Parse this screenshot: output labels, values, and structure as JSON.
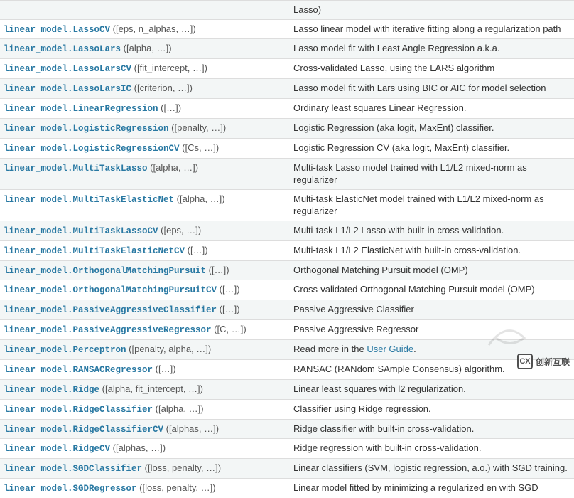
{
  "top_fragment": "Lasso)",
  "rows": [
    {
      "name": "linear_model.LassoCV",
      "params": " ([eps, n_alphas, …])",
      "desc": "Lasso linear model with iterative fitting along a regularization path"
    },
    {
      "name": "linear_model.LassoLars",
      "params": " ([alpha, …])",
      "desc": "Lasso model fit with Least Angle Regression a.k.a."
    },
    {
      "name": "linear_model.LassoLarsCV",
      "params": " ([fit_intercept, …])",
      "desc": "Cross-validated Lasso, using the LARS algorithm"
    },
    {
      "name": "linear_model.LassoLarsIC",
      "params": " ([criterion, …])",
      "desc": "Lasso model fit with Lars using BIC or AIC for model selection"
    },
    {
      "name": "linear_model.LinearRegression",
      "params": " ([…])",
      "desc": "Ordinary least squares Linear Regression."
    },
    {
      "name": "linear_model.LogisticRegression",
      "params": " ([penalty, …])",
      "desc": "Logistic Regression (aka logit, MaxEnt) classifier."
    },
    {
      "name": "linear_model.LogisticRegressionCV",
      "params": " ([Cs, …])",
      "desc": "Logistic Regression CV (aka logit, MaxEnt) classifier."
    },
    {
      "name": "linear_model.MultiTaskLasso",
      "params": " ([alpha, …])",
      "desc": "Multi-task Lasso model trained with L1/L2 mixed-norm as regularizer"
    },
    {
      "name": "linear_model.MultiTaskElasticNet",
      "params": " ([alpha, …])",
      "desc": "Multi-task ElasticNet model trained with L1/L2 mixed-norm as regularizer"
    },
    {
      "name": "linear_model.MultiTaskLassoCV",
      "params": " ([eps, …])",
      "desc": "Multi-task L1/L2 Lasso with built-in cross-validation."
    },
    {
      "name": "linear_model.MultiTaskElasticNetCV",
      "params": " ([…])",
      "desc": "Multi-task L1/L2 ElasticNet with built-in cross-validation."
    },
    {
      "name": "linear_model.OrthogonalMatchingPursuit",
      "params": " ([…])",
      "desc": "Orthogonal Matching Pursuit model (OMP)"
    },
    {
      "name": "linear_model.OrthogonalMatchingPursuitCV",
      "params": " ([…])",
      "desc": "Cross-validated Orthogonal Matching Pursuit model (OMP)"
    },
    {
      "name": "linear_model.PassiveAggressiveClassifier",
      "params": " ([…])",
      "desc": "Passive Aggressive Classifier"
    },
    {
      "name": "linear_model.PassiveAggressiveRegressor",
      "params": " ([C, …])",
      "desc": "Passive Aggressive Regressor"
    },
    {
      "name": "linear_model.Perceptron",
      "params": " ([penalty, alpha, …])",
      "desc_prefix": "Read more in the ",
      "link_text": "User Guide",
      "desc_suffix": "."
    },
    {
      "name": "linear_model.RANSACRegressor",
      "params": " ([…])",
      "desc": "RANSAC (RANdom SAmple Consensus) algorithm."
    },
    {
      "name": "linear_model.Ridge",
      "params": " ([alpha, fit_intercept, …])",
      "desc": "Linear least squares with l2 regularization."
    },
    {
      "name": "linear_model.RidgeClassifier",
      "params": " ([alpha, …])",
      "desc": "Classifier using Ridge regression."
    },
    {
      "name": "linear_model.RidgeClassifierCV",
      "params": " ([alphas, …])",
      "desc": "Ridge classifier with built-in cross-validation."
    },
    {
      "name": "linear_model.RidgeCV",
      "params": " ([alphas, …])",
      "desc": "Ridge regression with built-in cross-validation."
    },
    {
      "name": "linear_model.SGDClassifier",
      "params": " ([loss, penalty, …])",
      "desc": "Linear classifiers (SVM, logistic regression, a.o.) with SGD training."
    },
    {
      "name": "linear_model.SGDRegressor",
      "params": " ([loss, penalty, …])",
      "desc": "Linear model fitted by minimizing a regularized en with SGD"
    }
  ],
  "watermark": {
    "logo_text": "CX",
    "label": "创新互联"
  }
}
